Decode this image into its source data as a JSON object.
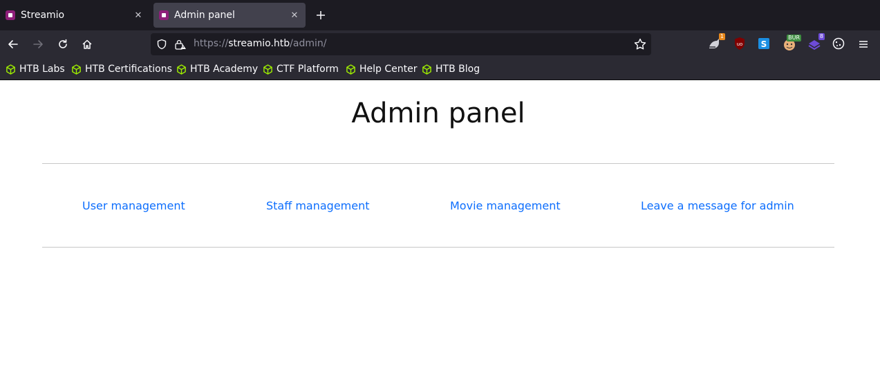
{
  "browser": {
    "tabs": [
      {
        "title": "Streamio",
        "active": false
      },
      {
        "title": "Admin panel",
        "active": true
      }
    ],
    "close_glyph": "✕",
    "new_tab_glyph": "+",
    "url": {
      "scheme": "https://",
      "host": "streamio.htb",
      "path": "/admin/"
    },
    "extensions": [
      {
        "name": "foxyproxy-icon",
        "badge": "1",
        "badge_color": "#e8891d"
      },
      {
        "name": "ublock-origin-icon",
        "badge": "",
        "badge_color": ""
      },
      {
        "name": "s-extension-icon",
        "badge": "",
        "badge_color": ""
      },
      {
        "name": "burp-icon",
        "badge": "BUR",
        "badge_color": "#3e8e41"
      },
      {
        "name": "wappalyzer-icon",
        "badge": "8",
        "badge_color": "#6d4bd8"
      },
      {
        "name": "cookie-editor-icon",
        "badge": "",
        "badge_color": ""
      }
    ],
    "bookmarks": [
      {
        "label": "HTB Labs"
      },
      {
        "label": "HTB Certifications"
      },
      {
        "label": "HTB Academy"
      },
      {
        "label": "CTF Platform"
      },
      {
        "label": "Help Center"
      },
      {
        "label": "HTB Blog"
      }
    ],
    "colors": {
      "toolbar": "#2b2a33",
      "tabstrip": "#1c1b22",
      "bookmark_icon": "#9fef00",
      "link": "#0d6efd"
    }
  },
  "page": {
    "title": "Admin panel",
    "links": [
      {
        "label": "User management"
      },
      {
        "label": "Staff management"
      },
      {
        "label": "Movie management"
      },
      {
        "label": "Leave a message for admin"
      }
    ]
  }
}
